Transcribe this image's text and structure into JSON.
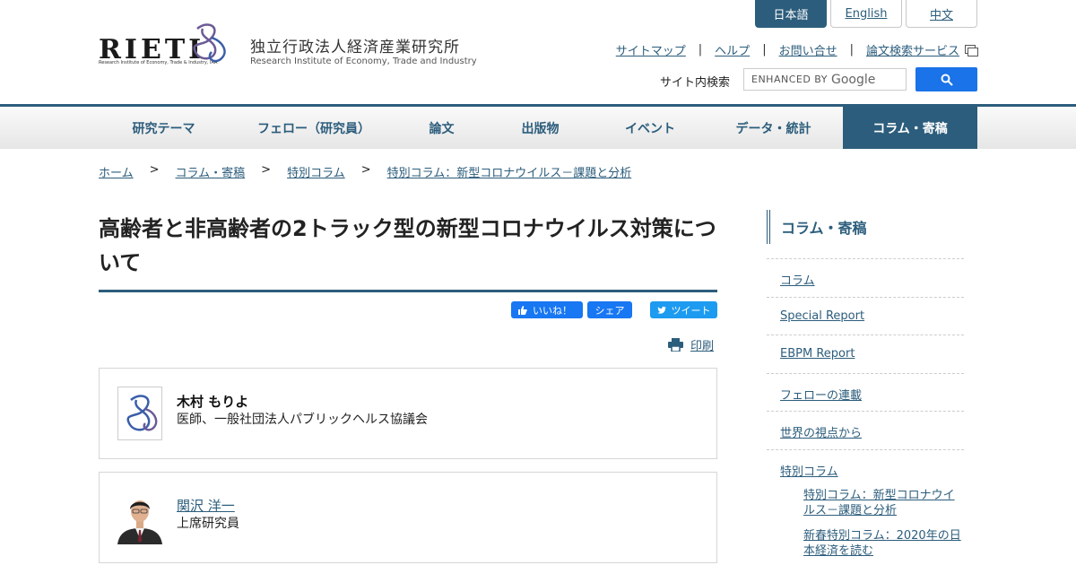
{
  "header": {
    "logo_text": "RIETI",
    "logo_subtext": "Research Institute of Economy, Trade & Industry, IAA",
    "org_name_jp": "独立行政法人経済産業研究所",
    "org_name_en": "Research Institute of Economy, Trade and Industry",
    "languages": [
      {
        "label": "日本語",
        "active": true
      },
      {
        "label": "English",
        "active": false
      },
      {
        "label": "中文",
        "active": false
      }
    ],
    "utility_links": [
      "サイトマップ",
      "ヘルプ",
      "お問い合せ",
      "論文検索サービス"
    ],
    "utility_separator": "|",
    "search_label": "サイト内検索",
    "search_placeholder_prefix": "ENHANCED BY",
    "search_placeholder_brand": "Google"
  },
  "nav": {
    "items": [
      {
        "label": "研究テーマ",
        "active": false
      },
      {
        "label": "フェロー（研究員）",
        "active": false
      },
      {
        "label": "論文",
        "active": false
      },
      {
        "label": "出版物",
        "active": false
      },
      {
        "label": "イベント",
        "active": false
      },
      {
        "label": "データ・統計",
        "active": false
      },
      {
        "label": "コラム・寄稿",
        "active": true
      }
    ]
  },
  "breadcrumb": {
    "separator": ">",
    "items": [
      "ホーム",
      "コラム・寄稿",
      "特別コラム",
      "特別コラム：新型コロナウイルス－課題と分析"
    ]
  },
  "article": {
    "title": "高齢者と非高齢者の2トラック型の新型コロナウイルス対策について",
    "fb_like": "いいね！",
    "fb_share": "シェア",
    "tweet": "ツイート",
    "print": "印刷",
    "authors": [
      {
        "name": "木村 もりよ",
        "affiliation": "医師、一般社団法人パブリックヘルス協議会",
        "linked": false
      },
      {
        "name": "関沢 洋一",
        "affiliation": "上席研究員",
        "linked": true
      }
    ]
  },
  "sidebar": {
    "heading": "コラム・寄稿",
    "items": [
      "コラム",
      "Special Report",
      "EBPM Report",
      "フェローの連載",
      "世界の視点から",
      "特別コラム"
    ],
    "subitems": [
      "特別コラム：新型コロナウイルス－課題と分析",
      "新春特別コラム：2020年の日本経済を読む"
    ]
  },
  "colors": {
    "brand": "#2c5d7c",
    "search_button": "#1a73e8",
    "facebook": "#1877f2",
    "twitter": "#1d9bf0"
  }
}
